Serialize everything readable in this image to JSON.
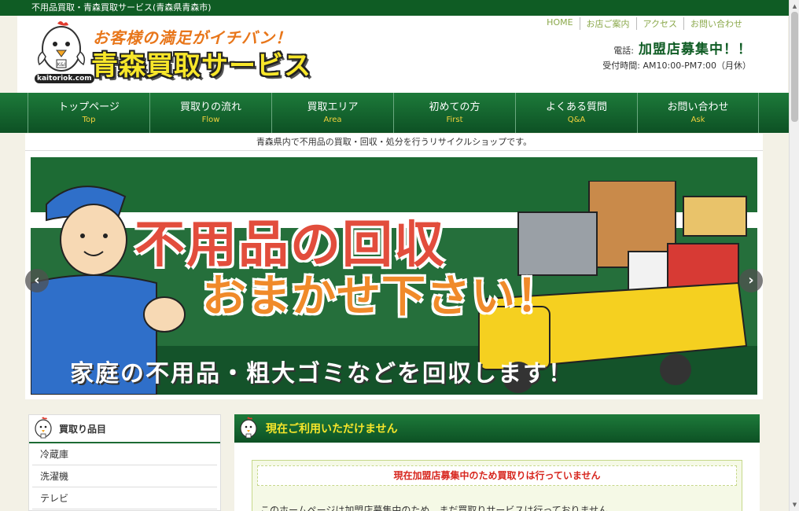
{
  "topbar": {
    "text": "不用品買取・青森買取サービス(青森県青森市)"
  },
  "header": {
    "slogan": "お客様の満足がイチバン！",
    "brand": "青森買取サービス",
    "site_url": "kaitoriok.com",
    "nav": [
      "HOME",
      "お店ご案内",
      "アクセス",
      "お問い合わせ"
    ],
    "phone_label": "電話:",
    "phone_value": "加盟店募集中！！",
    "hours": "受付時間: AM10:00-PM7:00（月休）"
  },
  "main_nav": [
    {
      "jp": "トップページ",
      "en": "Top"
    },
    {
      "jp": "買取りの流れ",
      "en": "Flow"
    },
    {
      "jp": "買取エリア",
      "en": "Area"
    },
    {
      "jp": "初めての方",
      "en": "First"
    },
    {
      "jp": "よくある質問",
      "en": "Q&A"
    },
    {
      "jp": "お問い合わせ",
      "en": "Ask"
    }
  ],
  "tagline": "青森県内で不用品の買取・回収・処分を行うリサイクルショップです。",
  "banner": {
    "title_line1": "不用品の回収",
    "title_line2": "おまかせ下さい！",
    "subtitle": "家庭の不用品・粗大ゴミなどを回収します！",
    "prev": "‹",
    "next": "›"
  },
  "sidebar": {
    "heading": "買取り品目",
    "items": [
      "冷蔵庫",
      "洗濯機",
      "テレビ"
    ]
  },
  "content": {
    "title": "現在ご利用いただけません",
    "notice": "現在加盟店募集中のため買取りは行っていません",
    "body_cut": "このホームページは加盟店募集中のため、まだ買取りサービスは行っておりません。"
  },
  "colors": {
    "brand_green": "#0f5c24",
    "accent_yellow": "#f7e62a",
    "notice_red": "#d7261e"
  }
}
